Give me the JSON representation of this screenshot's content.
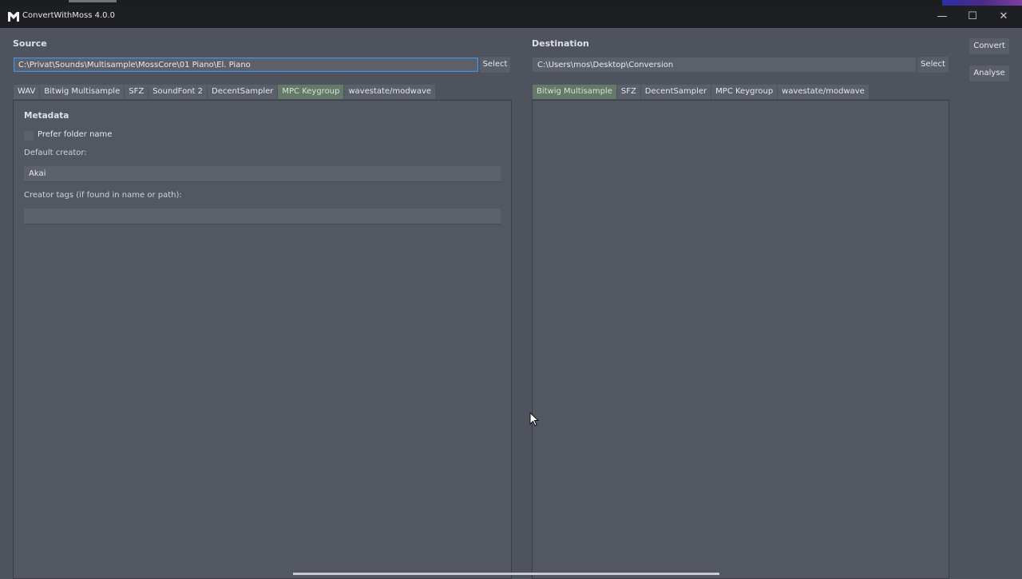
{
  "window": {
    "title": "ConvertWithMoss 4.0.0",
    "icons": {
      "app": "app-icon",
      "minimize": "minimize-icon",
      "maximize": "maximize-icon",
      "close": "close-icon"
    },
    "minimize_glyph": "—",
    "maximize_glyph": "☐",
    "close_glyph": "✕"
  },
  "source": {
    "label": "Source",
    "path": "C:\\Privat\\Sounds\\Multisample\\MossCore\\01 Piano\\El. Piano",
    "select_label": "Select",
    "tabs": [
      {
        "label": "WAV",
        "active": false
      },
      {
        "label": "Bitwig Multisample",
        "active": false
      },
      {
        "label": "SFZ",
        "active": false
      },
      {
        "label": "SoundFont 2",
        "active": false
      },
      {
        "label": "DecentSampler",
        "active": false
      },
      {
        "label": "MPC Keygroup",
        "active": true
      },
      {
        "label": "wavestate/modwave",
        "active": false
      }
    ],
    "metadata": {
      "title": "Metadata",
      "prefer_folder_label": "Prefer folder name",
      "prefer_folder_checked": false,
      "default_creator_label": "Default creator:",
      "default_creator_value": "Akai",
      "creator_tags_label": "Creator tags (if found in name or path):",
      "creator_tags_value": ""
    }
  },
  "destination": {
    "label": "Destination",
    "path": "C:\\Users\\mos\\Desktop\\Conversion",
    "select_label": "Select",
    "tabs": [
      {
        "label": "Bitwig Multisample",
        "active": true
      },
      {
        "label": "SFZ",
        "active": false
      },
      {
        "label": "DecentSampler",
        "active": false
      },
      {
        "label": "MPC Keygroup",
        "active": false
      },
      {
        "label": "wavestate/modwave",
        "active": false
      }
    ]
  },
  "actions": {
    "convert_label": "Convert",
    "analyse_label": "Analyse"
  },
  "colors": {
    "background": "#4e535e",
    "active_tab": "#65796a",
    "focus_border": "#5a8fc6"
  }
}
